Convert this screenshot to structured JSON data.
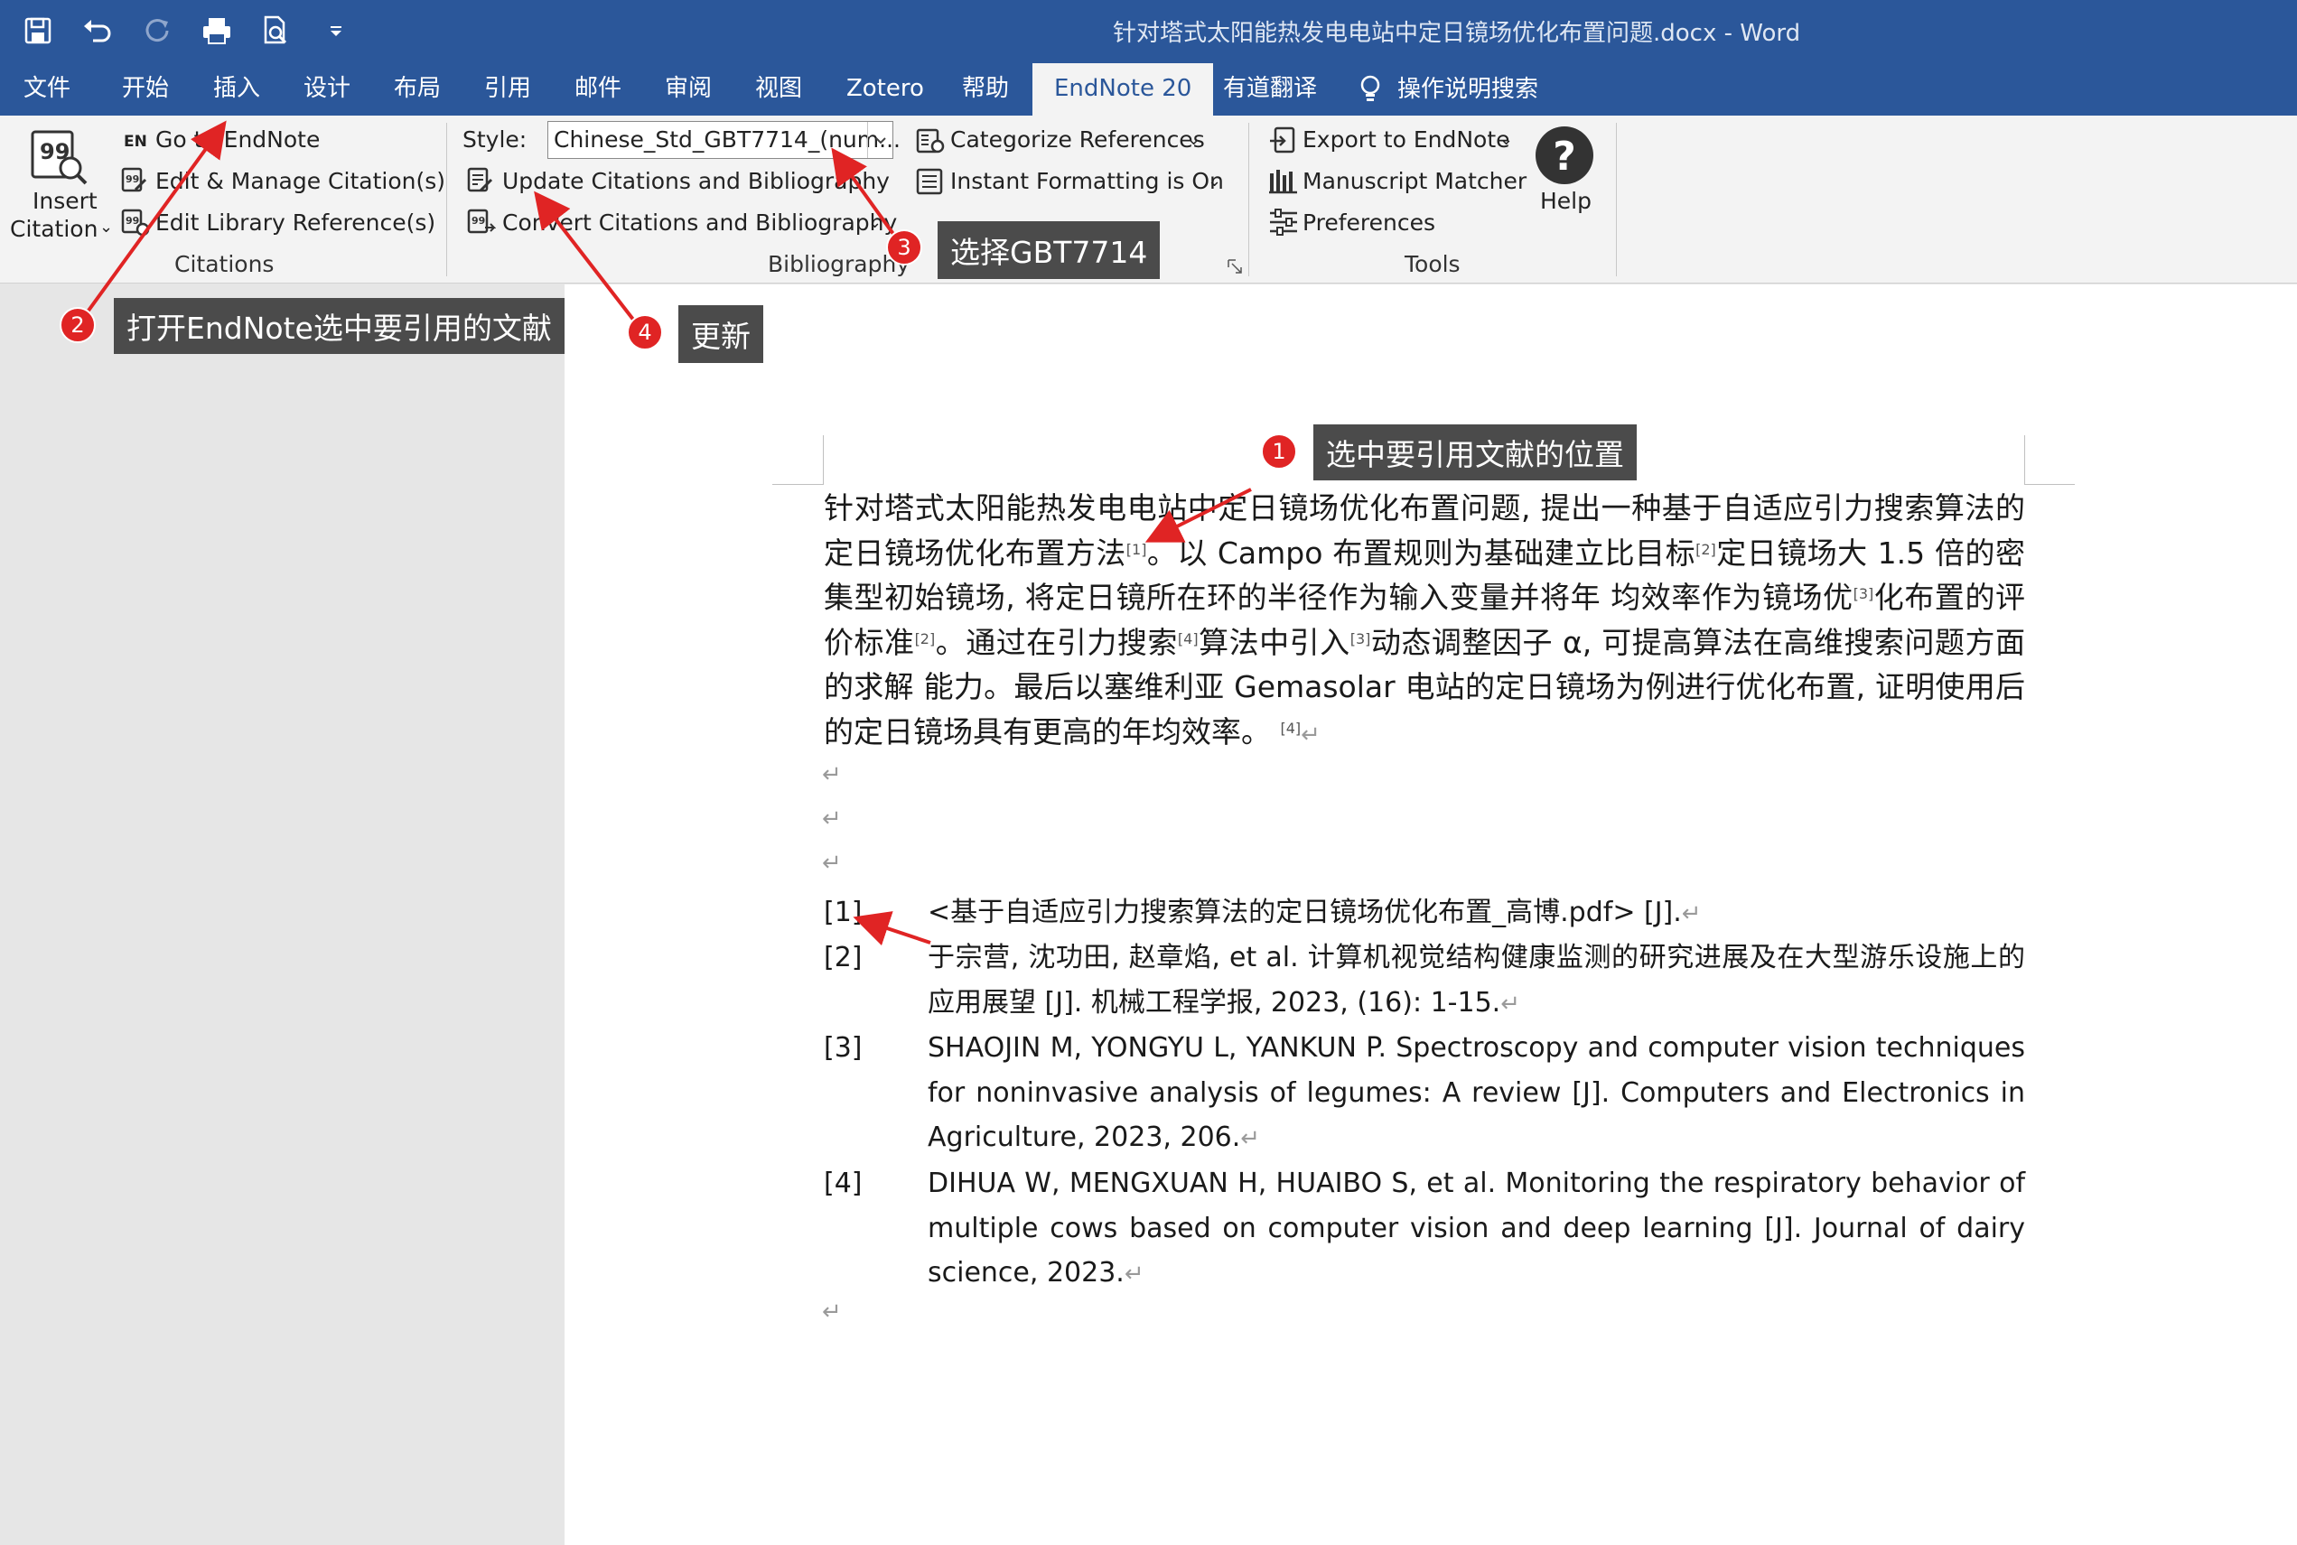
{
  "window": {
    "title": "针对塔式太阳能热发电电站中定日镜场优化布置问题.docx  -  Word"
  },
  "quick_access": [
    "save-icon",
    "undo-icon",
    "redo-icon",
    "print-preview-icon",
    "customize-icon"
  ],
  "tabs": [
    "文件",
    "开始",
    "插入",
    "设计",
    "布局",
    "引用",
    "邮件",
    "审阅",
    "视图",
    "Zotero",
    "帮助",
    "EndNote 20",
    "有道翻译",
    "操作说明搜索"
  ],
  "active_tab": "EndNote 20",
  "ribbon": {
    "citations": {
      "insert_label_1": "Insert",
      "insert_label_2": "Citation",
      "en_badge": "EN",
      "go_to": "Go to EndNote",
      "edit_manage": "Edit & Manage Citation(s)",
      "edit_library": "Edit Library Reference(s)",
      "group_label": "Citations"
    },
    "bibliography": {
      "style_label": "Style:",
      "style_value": "Chinese_Std_GBT7714_(num...",
      "update": "Update Citations and Bibliography",
      "convert": "Convert Citations and Bibliography",
      "categorize": "Categorize References",
      "instant": "Instant Formatting is On",
      "group_label": "Bibliography"
    },
    "tools": {
      "export": "Export to EndNote",
      "manuscript": "Manuscript Matcher",
      "preferences": "Preferences",
      "help": "Help",
      "group_label": "Tools"
    }
  },
  "document": {
    "para_segments": [
      "针对塔式太阳能热发电电站中定日镜场优化布置问题, 提出一种基于自适应引力搜索算法的定日镜场优化布置方法",
      "[1]",
      "。以 Campo 布置规则为基础建立比目标",
      "[2]",
      "定日镜场大 1.5 倍的密集型初始镜场, 将定日镜所在环的半径作为输入变量并将年  均效率作为镜场优",
      "[3]",
      "化布置的评价标准",
      "[2]",
      "。通过在引力搜索",
      "[4]",
      "算法中引入",
      "[3]",
      "动态调整因子 α, 可提高算法在高维搜索问题方面的求解  能力。最后以塞维利亚 Gemasolar 电站的定日镜场为例进行优化布置, 证明使用后的定日镜场具有更高的年均效率。",
      "[4]"
    ],
    "paragraph_mark": "↵",
    "references": [
      {
        "num": "[1]",
        "text": "<基于自适应引力搜索算法的定日镜场优化布置_高博.pdf> [J]."
      },
      {
        "num": "[2]",
        "text": "于宗营, 沈功田, 赵章焰, et al. 计算机视觉结构健康监测的研究进展及在大型游乐设施上的应用展望  [J]. 机械工程学报, 2023, (16): 1-15."
      },
      {
        "num": "[3]",
        "text": "SHAOJIN M, YONGYU L, YANKUN P. Spectroscopy and computer vision techniques for noninvasive analysis of legumes: A review [J]. Computers and Electronics in Agriculture, 2023, 206."
      },
      {
        "num": "[4]",
        "text": "DIHUA W, MENGXUAN H, HUAIBO S, et al. Monitoring the respiratory behavior of multiple cows based on computer vision and deep learning [J]. Journal of dairy science, 2023."
      }
    ]
  },
  "annotations": [
    {
      "num": "1",
      "text": "选中要引用文献的位置"
    },
    {
      "num": "2",
      "text": "打开EndNote选中要引用的文献"
    },
    {
      "num": "3",
      "text": "选择GBT7714"
    },
    {
      "num": "4",
      "text": "更新"
    }
  ],
  "colors": {
    "title_bar": "#2b579a",
    "ribbon": "#f3f3f3",
    "annotation_red": "#e02424",
    "callout_bg": "#4b4b4b"
  }
}
